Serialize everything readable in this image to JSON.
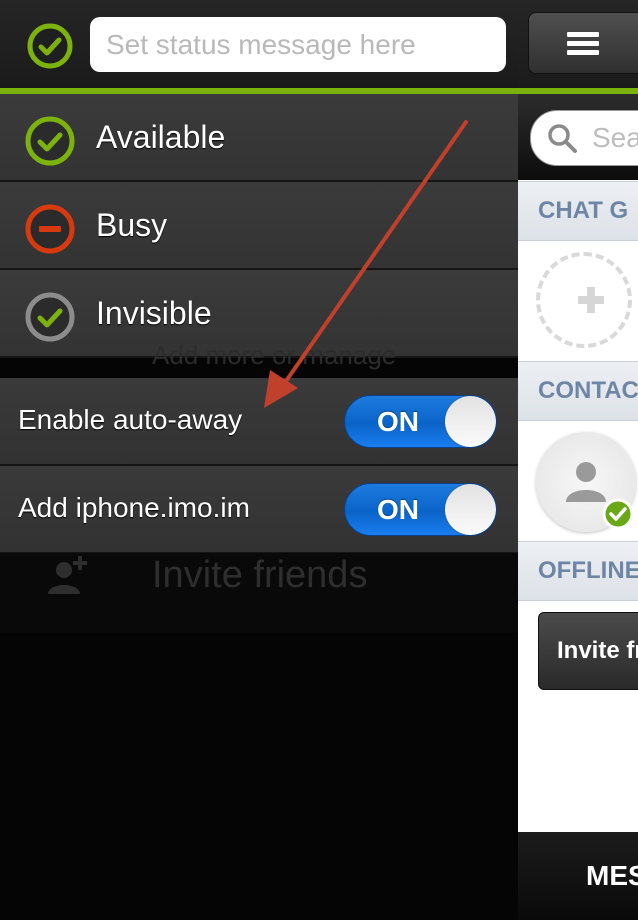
{
  "status_panel": {
    "current_status_icon": "available-check-icon",
    "status_message_placeholder": "Set status message here",
    "statuses": [
      {
        "label": "Available",
        "icon": "available-check-icon",
        "color": "#7cb20e"
      },
      {
        "label": "Busy",
        "icon": "busy-minus-icon",
        "color": "#d83a10"
      },
      {
        "label": "Invisible",
        "icon": "invisible-check-icon",
        "color": "#8c8c8c"
      }
    ],
    "hidden_manage_text": "Add more or manage",
    "toggles": [
      {
        "label": "Enable auto-away",
        "state": "ON"
      },
      {
        "label": "Add iphone.imo.im",
        "state": "ON"
      }
    ],
    "invite_label": "Invite friends"
  },
  "main_panel": {
    "search_placeholder": "Sea",
    "section_chat_groups": "CHAT G",
    "section_contacts": "CONTAC",
    "section_offline": "OFFLINE",
    "invite_button_label": "Invite fr",
    "bottom_tab_label": "MES"
  },
  "colors": {
    "accent_green": "#7cb20e",
    "toggle_blue": "#1a74e0",
    "busy_red": "#d83a10",
    "annotation_arrow": "#c0402c"
  }
}
